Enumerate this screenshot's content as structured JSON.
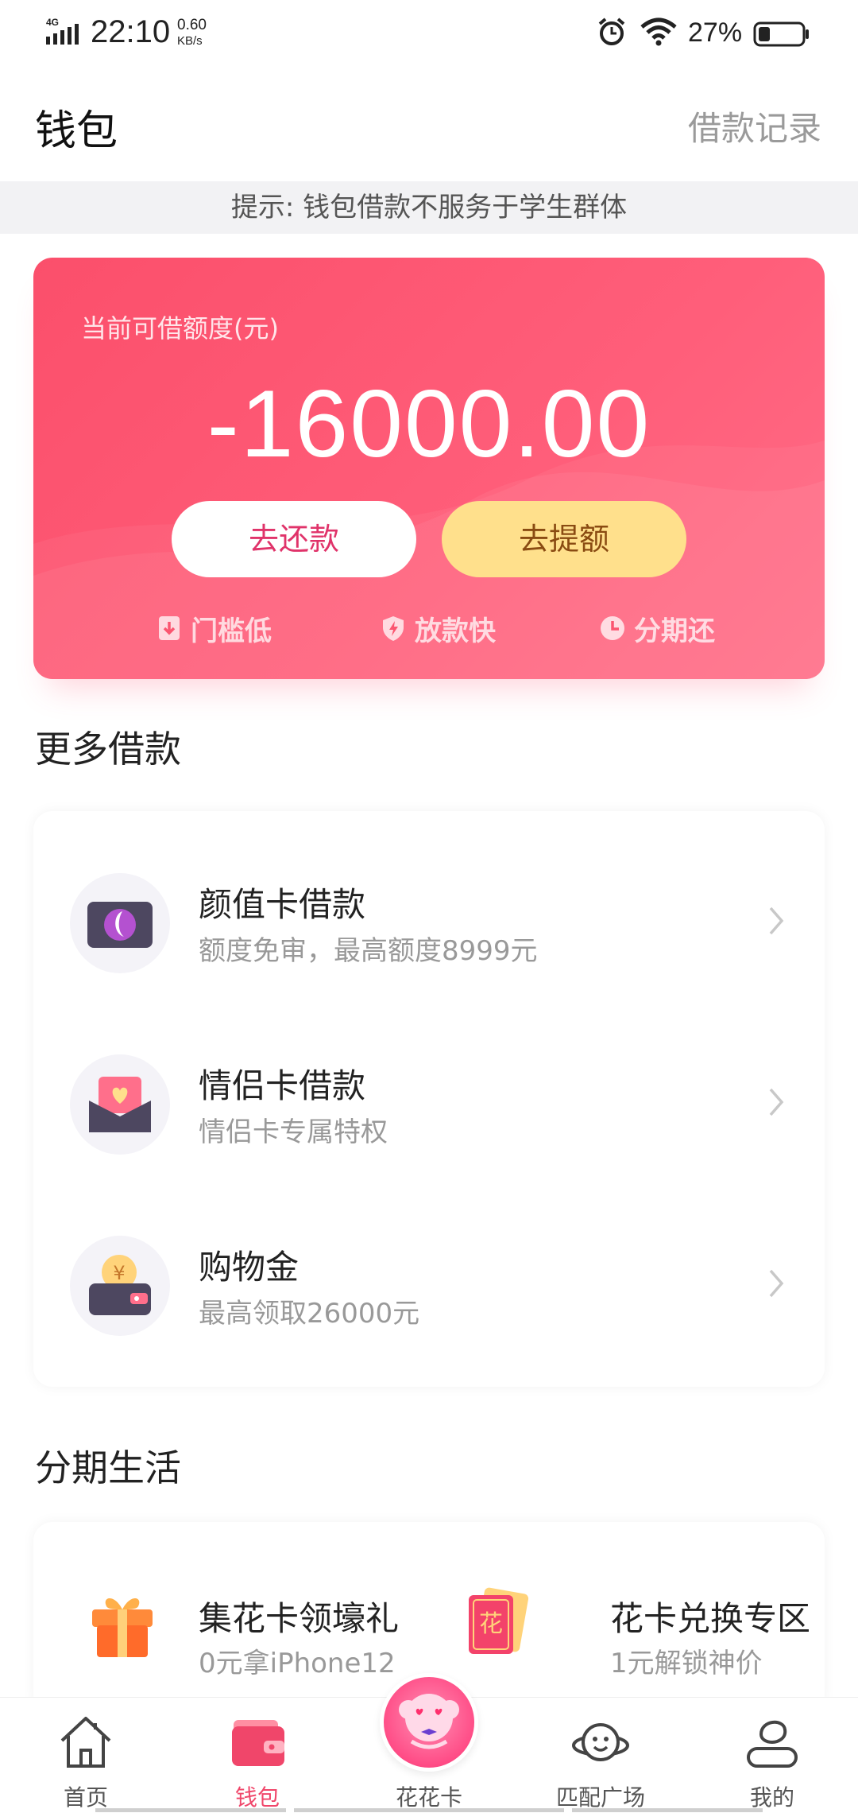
{
  "status_bar": {
    "network": "4G",
    "time": "22:10",
    "speed_value": "0.60",
    "speed_unit": "KB/s",
    "battery": "27%"
  },
  "header": {
    "title": "钱包",
    "loan_record": "借款记录"
  },
  "notice": "提示: 钱包借款不服务于学生群体",
  "credit": {
    "label": "当前可借额度(元)",
    "amount": "-16000.00",
    "repay_button": "去还款",
    "raise_button": "去提额",
    "features": [
      "门槛低",
      "放款快",
      "分期还"
    ]
  },
  "more_loans": {
    "title": "更多借款",
    "items": [
      {
        "title": "颜值卡借款",
        "subtitle": "额度免审，最高额度8999元",
        "icon": "beauty-card-icon"
      },
      {
        "title": "情侣卡借款",
        "subtitle": "情侣卡专属特权",
        "icon": "couple-card-icon"
      },
      {
        "title": "购物金",
        "subtitle": "最高领取26000元",
        "icon": "shopping-wallet-icon"
      }
    ]
  },
  "installment_life": {
    "title": "分期生活",
    "items": [
      {
        "title": "集花卡领壕礼",
        "subtitle": "0元拿iPhone12",
        "icon": "gift-box-icon"
      },
      {
        "title": "花卡兑换专区",
        "subtitle": "1元解锁神价",
        "icon": "flower-card-icon"
      }
    ]
  },
  "tab_bar": {
    "tabs": [
      {
        "label": "首页",
        "icon": "home-icon"
      },
      {
        "label": "钱包",
        "icon": "wallet-icon"
      },
      {
        "label": "花花卡",
        "icon": "flower-avatar-icon"
      },
      {
        "label": "匹配广场",
        "icon": "planet-face-icon"
      },
      {
        "label": "我的",
        "icon": "profile-icon"
      }
    ],
    "active_index": 1
  },
  "colors": {
    "accent": "#f0466a",
    "card_start": "#fb4f6b",
    "raise_button_bg": "#ffe08c"
  }
}
